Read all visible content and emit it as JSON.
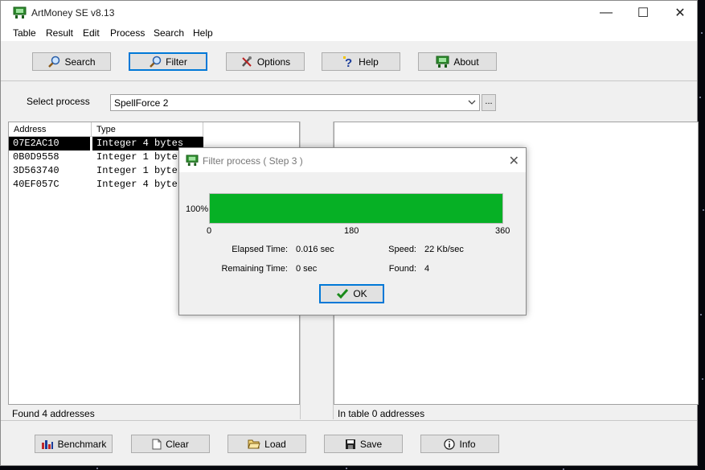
{
  "window": {
    "title": "ArtMoney SE v8.13",
    "controls": {
      "minimize": "—",
      "maximize": "☐",
      "close": "✕"
    }
  },
  "menu": [
    "Table",
    "Result",
    "Edit",
    "Process",
    "Search",
    "Help"
  ],
  "toolbar": {
    "search": "Search",
    "filter": "Filter",
    "options": "Options",
    "help": "Help",
    "about": "About"
  },
  "process": {
    "label": "Select process",
    "value": "SpellForce 2",
    "browse": "..."
  },
  "results": {
    "columns": [
      "Address",
      "Type"
    ],
    "rows": [
      {
        "address": "07E2AC10",
        "type": "Integer 4 bytes"
      },
      {
        "address": "0B0D9558",
        "type": "Integer 1 byte"
      },
      {
        "address": "3D563740",
        "type": "Integer 1 byte"
      },
      {
        "address": "40EF057C",
        "type": "Integer 4 byte"
      }
    ],
    "status": "Found 4 addresses"
  },
  "table": {
    "status": "In table 0 addresses"
  },
  "bottom": {
    "benchmark": "Benchmark",
    "clear": "Clear",
    "load": "Load",
    "save": "Save",
    "info": "Info"
  },
  "dialog": {
    "title": "Filter process ( Step 3 )",
    "close": "✕",
    "percent_label": "100%",
    "progress_fraction": 1.0,
    "ticks": [
      "0",
      "180",
      "360"
    ],
    "elapsed_label": "Elapsed Time:",
    "elapsed_value": "0.016 sec",
    "remaining_label": "Remaining Time:",
    "remaining_value": "0 sec",
    "speed_label": "Speed:",
    "speed_value": "22 Kb/sec",
    "found_label": "Found:",
    "found_value": "4",
    "ok": "OK"
  },
  "colors": {
    "progress": "#06b025",
    "focus": "#0078d7",
    "selection": "#000000"
  },
  "icons": [
    "app-icon",
    "search-icon",
    "filter-icon",
    "options-icon",
    "help-icon",
    "about-icon",
    "benchmark-icon",
    "clear-icon",
    "load-icon",
    "save-icon",
    "info-icon",
    "checkmark-icon",
    "chevron-down-icon"
  ]
}
